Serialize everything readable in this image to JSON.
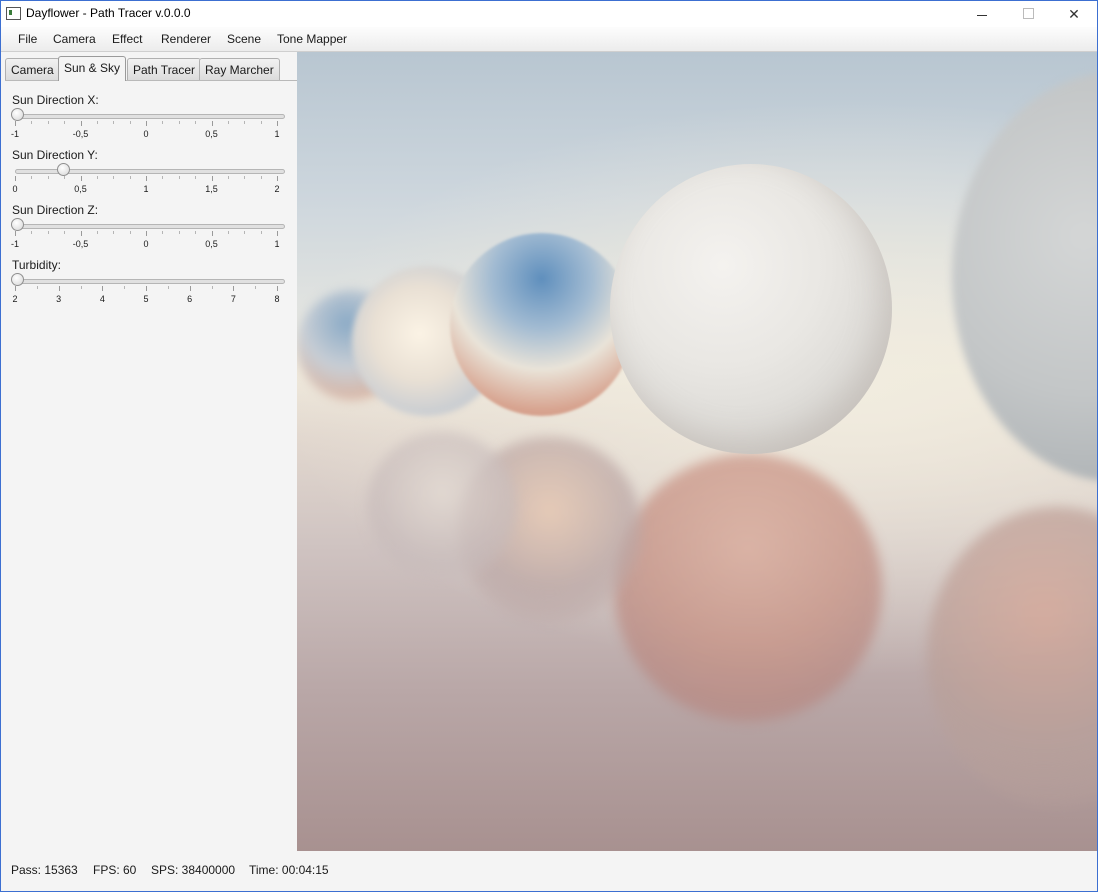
{
  "window": {
    "title": "Dayflower - Path Tracer v.0.0.0"
  },
  "menubar": {
    "items": [
      {
        "label": "File"
      },
      {
        "label": "Camera"
      },
      {
        "label": "Effect"
      },
      {
        "label": "Renderer"
      },
      {
        "label": "Scene"
      },
      {
        "label": "Tone Mapper"
      }
    ]
  },
  "tabs": [
    {
      "label": "Camera"
    },
    {
      "label": "Sun & Sky",
      "active": true
    },
    {
      "label": "Path Tracer"
    },
    {
      "label": "Ray Marcher"
    }
  ],
  "sliders": [
    {
      "label": "Sun Direction X:",
      "min": -1,
      "max": 1,
      "value": -1,
      "tick_labels": [
        "-1",
        "-0,5",
        "0",
        "0,5",
        "1"
      ]
    },
    {
      "label": "Sun Direction Y:",
      "min": 0,
      "max": 2,
      "value": 0.35,
      "tick_labels": [
        "0",
        "0,5",
        "1",
        "1,5",
        "2"
      ]
    },
    {
      "label": "Sun Direction Z:",
      "min": -1,
      "max": 1,
      "value": -1,
      "tick_labels": [
        "-1",
        "-0,5",
        "0",
        "0,5",
        "1"
      ]
    },
    {
      "label": "Turbidity:",
      "min": 2,
      "max": 8,
      "value": 2,
      "tick_labels": [
        "2",
        "3",
        "4",
        "5",
        "6",
        "7",
        "8"
      ]
    }
  ],
  "status": {
    "pass": "Pass: 15363",
    "fps": "FPS: 60",
    "sps": "SPS: 38400000",
    "time": "Time: 00:04:15"
  }
}
